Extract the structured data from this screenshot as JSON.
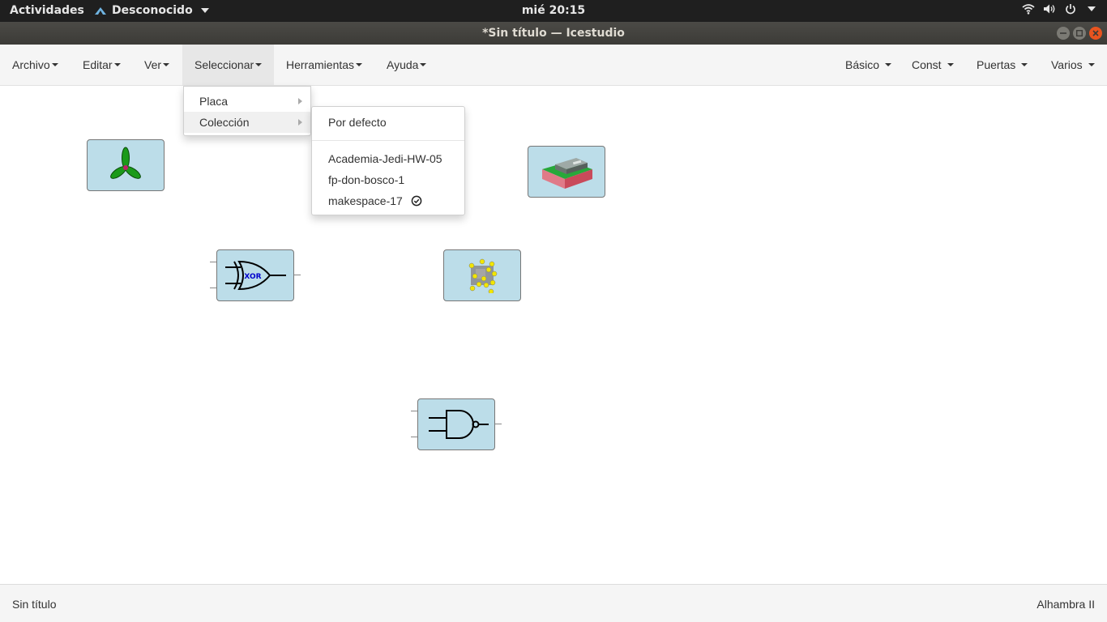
{
  "system_bar": {
    "activities": "Actividades",
    "app_name": "Desconocido",
    "clock": "mié 20:15"
  },
  "window": {
    "title": "*Sin título — Icestudio"
  },
  "menubar": {
    "left": [
      "Archivo",
      "Editar",
      "Ver",
      "Seleccionar",
      "Herramientas",
      "Ayuda"
    ],
    "active": "Seleccionar",
    "right": [
      "Básico",
      "Const",
      "Puertas",
      "Varios"
    ]
  },
  "select_menu": {
    "items": [
      "Placa",
      "Colección"
    ],
    "hovered": "Colección"
  },
  "collection_menu": {
    "default": "Por defecto",
    "items": [
      "Academia-Jedi-HW-05",
      "fp-don-bosco-1",
      "makespace-17"
    ],
    "selected": "makespace-17"
  },
  "canvas": {
    "xor_label": "XOR"
  },
  "statusbar": {
    "file": "Sin título",
    "board": "Alhambra II"
  },
  "colors": {
    "block_fill": "#bcdde9",
    "topbar_bg": "#1f1f1f",
    "menubar_bg": "#f5f5f5",
    "close_button": "#e9541f"
  }
}
